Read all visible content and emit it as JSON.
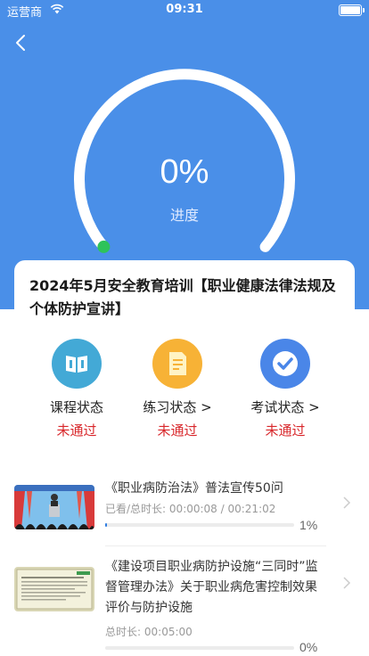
{
  "status_bar": {
    "carrier": "运营商",
    "time": "09:31"
  },
  "progress": {
    "value": "0%",
    "label": "进度",
    "fraction": 0.0
  },
  "course": {
    "title": "2024年5月安全教育培训【职业健康法律法规及个体防护宣讲】"
  },
  "statuses": [
    {
      "name": "课程状态",
      "value": "未通过",
      "icon": "book-icon",
      "color": "#43a9d6"
    },
    {
      "name": "练习状态 >",
      "value": "未通过",
      "icon": "document-icon",
      "color": "#f7b236"
    },
    {
      "name": "考试状态 >",
      "value": "未通过",
      "icon": "check-circle-icon",
      "color": "#4a86e8"
    }
  ],
  "lessons": [
    {
      "title": "《职业病防治法》普法宣传50问",
      "meta_label": "已看/总时长:",
      "meta_value": "00:00:08 / 00:21:02",
      "progress_fraction": 0.01,
      "pct": "1%"
    },
    {
      "title": "《建设项目职业病防护设施“三同时”监督管理办法》关于职业病危害控制效果评价与防护设施",
      "meta_label": "总时长:",
      "meta_value": "00:05:00",
      "progress_fraction": 0.0,
      "pct": "0%"
    }
  ],
  "colors": {
    "header": "#4a8fe8",
    "fail": "#d8262a",
    "bar": "#2f7de1",
    "dot": "#2ec35a"
  }
}
